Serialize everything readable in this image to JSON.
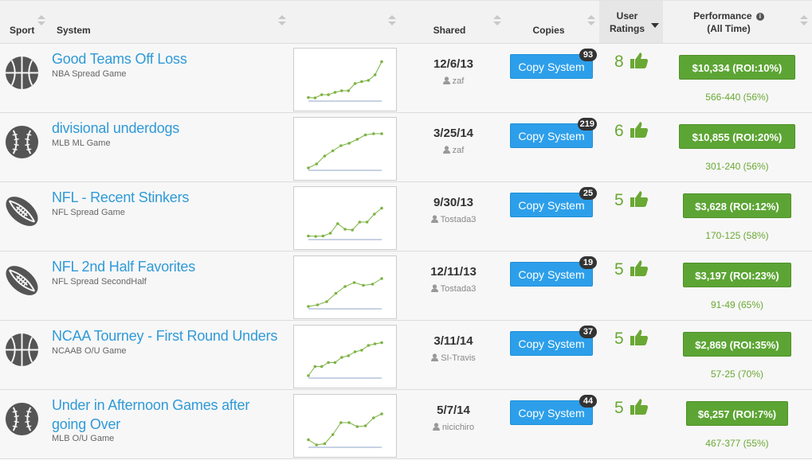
{
  "header": {
    "sport": "Sport",
    "system": "System",
    "shared": "Shared",
    "copies": "Copies",
    "user_ratings_line1": "User",
    "user_ratings_line2": "Ratings",
    "performance_line1": "Performance",
    "performance_line2": "(All Time)"
  },
  "colors": {
    "link": "#2f9ad8",
    "copy_button": "#2d9fea",
    "performance_button": "#5ca534",
    "rating_green": "#6aa834",
    "spark_line": "#7cb342"
  },
  "copy_label": "Copy System",
  "rows": [
    {
      "sport_icon": "basketball-icon",
      "title": "Good Teams Off Loss",
      "subtitle": "NBA Spread Game",
      "date": "12/6/13",
      "user": "zaf",
      "copies": "93",
      "rating": "8",
      "performance": "$10,334 (ROI:10%)",
      "record": "566-440 (56%)",
      "spark": [
        0.05,
        0.04,
        0.12,
        0.12,
        0.18,
        0.22,
        0.22,
        0.4,
        0.45,
        0.48,
        0.62,
        0.95
      ]
    },
    {
      "sport_icon": "baseball-icon",
      "title": "divisional underdogs",
      "subtitle": "MLB ML Game",
      "date": "3/25/14",
      "user": "zaf",
      "copies": "219",
      "rating": "6",
      "performance": "$10,855 (ROI:20%)",
      "record": "301-240 (56%)",
      "spark": [
        0.02,
        0.12,
        0.32,
        0.45,
        0.58,
        0.64,
        0.74,
        0.85,
        0.88,
        0.88
      ]
    },
    {
      "sport_icon": "football-icon",
      "title": "NFL - Recent Stinkers",
      "subtitle": "NFL Spread Game",
      "date": "9/30/13",
      "user": "Tostada3",
      "copies": "25",
      "rating": "5",
      "performance": "$3,628 (ROI:12%)",
      "record": "170-125 (58%)",
      "spark": [
        0.05,
        0.04,
        0.05,
        0.12,
        0.36,
        0.22,
        0.2,
        0.4,
        0.4,
        0.6,
        0.75
      ]
    },
    {
      "sport_icon": "football-icon",
      "title": "NFL 2nd Half Favorites",
      "subtitle": "NFL Spread SecondHalf",
      "date": "12/11/13",
      "user": "Tostada3",
      "copies": "19",
      "rating": "5",
      "performance": "$3,197 (ROI:23%)",
      "record": "91-49 (65%)",
      "spark": [
        0.02,
        0.06,
        0.14,
        0.35,
        0.52,
        0.62,
        0.55,
        0.58,
        0.72
      ]
    },
    {
      "sport_icon": "basketball-icon",
      "title": "NCAA Tourney - First Round Unders",
      "subtitle": "NCAAB O/U Game",
      "date": "3/11/14",
      "user": "SI-Travis",
      "copies": "37",
      "rating": "5",
      "performance": "$2,869 (ROI:35%)",
      "record": "57-25 (70%)",
      "spark": [
        0.02,
        0.25,
        0.25,
        0.35,
        0.35,
        0.48,
        0.52,
        0.62,
        0.66,
        0.78,
        0.82,
        0.85
      ]
    },
    {
      "sport_icon": "baseball-icon",
      "title": "Under in Afternoon Games after going Over",
      "subtitle": "MLB O/U Game",
      "date": "5/7/14",
      "user": "nicichiro",
      "copies": "44",
      "rating": "5",
      "performance": "$6,257 (ROI:7%)",
      "record": "467-377 (55%)",
      "spark": [
        0.15,
        0.02,
        0.05,
        0.28,
        0.58,
        0.58,
        0.48,
        0.5,
        0.7,
        0.8
      ]
    }
  ]
}
